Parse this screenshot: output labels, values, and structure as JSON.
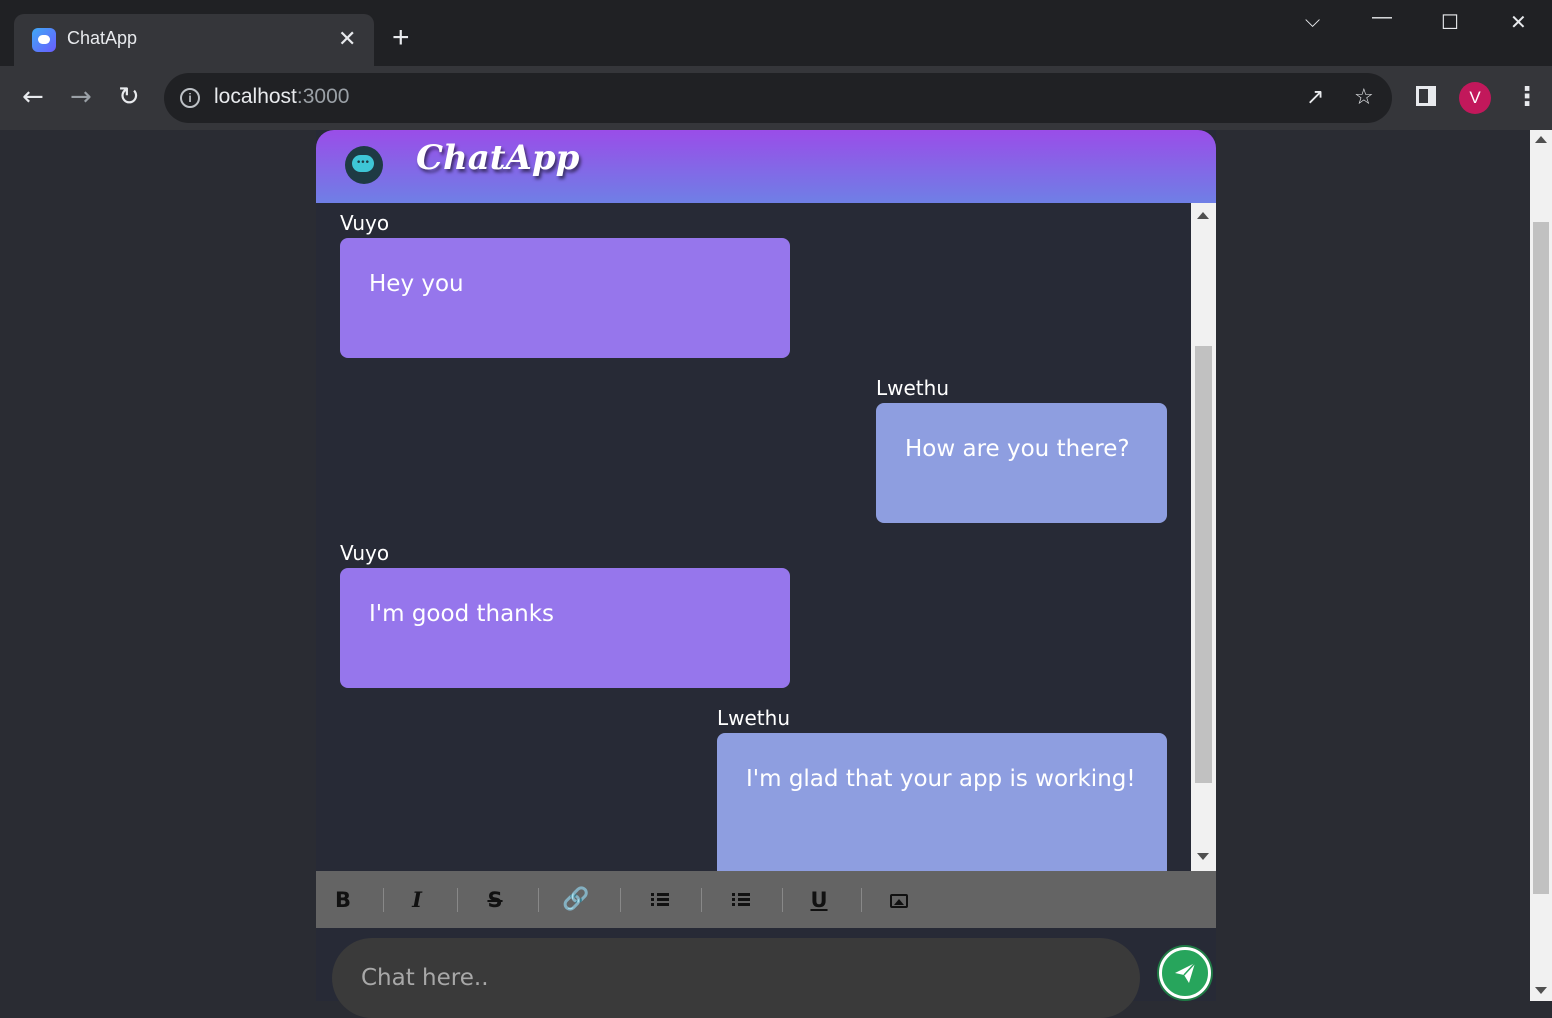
{
  "browser": {
    "tab_title": "ChatApp",
    "tab_close": "✕",
    "new_tab": "+",
    "url_host": "localhost",
    "url_port": ":3000",
    "avatar_letter": "V",
    "window_controls": {
      "dropdown": "⌵",
      "minimize": "—",
      "maximize": "☐",
      "close": "✕"
    }
  },
  "app": {
    "brand": "ChatApp",
    "messages": [
      {
        "sender": "Vuyo",
        "text": "Hey you",
        "side": "left"
      },
      {
        "sender": "Lwethu",
        "text": "How are you there?",
        "side": "right"
      },
      {
        "sender": "Vuyo",
        "text": "I'm good thanks",
        "side": "left"
      },
      {
        "sender": "Lwethu",
        "text": "I'm glad that your app is working!",
        "side": "right"
      }
    ],
    "format_toolbar": {
      "bold": "B",
      "italic": "I",
      "strike": "S",
      "underline": "U"
    },
    "input": {
      "placeholder": "Chat here.."
    }
  },
  "colors": {
    "header_top": "#9a4de8",
    "header_bottom": "#6f7fe6",
    "bubble_left": "#9676ec",
    "bubble_right": "#8e9ee0",
    "send_button": "#27a55c",
    "avatar": "#c2185b"
  }
}
